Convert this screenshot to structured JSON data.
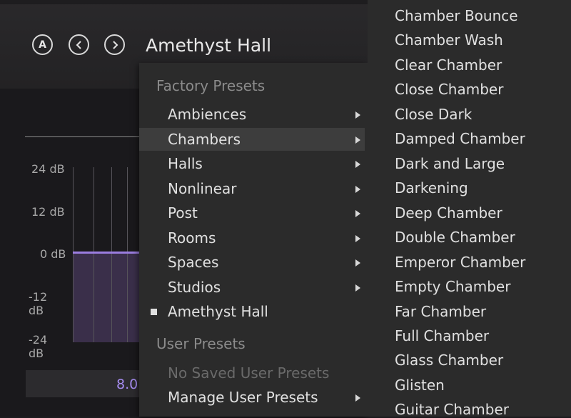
{
  "header": {
    "ab_button_label": "A",
    "preset_name": "Amethyst Hall",
    "prev_icon": "chevron-left-icon",
    "next_icon": "chevron-right-icon"
  },
  "graph": {
    "db_labels": [
      "24 dB",
      "12 dB",
      "0 dB",
      "-12 dB",
      "-24 dB"
    ],
    "value_readout": "8.0",
    "curve_color": "#9b7de0"
  },
  "menu": {
    "factory_heading": "Factory Presets",
    "factory_items": [
      {
        "label": "Ambiences",
        "submenu": true
      },
      {
        "label": "Chambers",
        "submenu": true,
        "highlighted": true
      },
      {
        "label": "Halls",
        "submenu": true
      },
      {
        "label": "Nonlinear",
        "submenu": true
      },
      {
        "label": "Post",
        "submenu": true
      },
      {
        "label": "Rooms",
        "submenu": true
      },
      {
        "label": "Spaces",
        "submenu": true
      },
      {
        "label": "Studios",
        "submenu": true
      },
      {
        "label": "Amethyst Hall",
        "checked": true
      }
    ],
    "user_heading": "User Presets",
    "no_user_presets": "No Saved User Presets",
    "manage_user_presets": "Manage User Presets"
  },
  "submenu": {
    "items": [
      "Chamber Bounce",
      "Chamber Wash",
      "Clear Chamber",
      "Close Chamber",
      "Close Dark",
      "Damped Chamber",
      "Dark and Large",
      "Darkening",
      "Deep Chamber",
      "Double Chamber",
      "Emperor Chamber",
      "Empty Chamber",
      "Far Chamber",
      "Full Chamber",
      "Glass Chamber",
      "Glisten",
      "Guitar Chamber"
    ]
  }
}
